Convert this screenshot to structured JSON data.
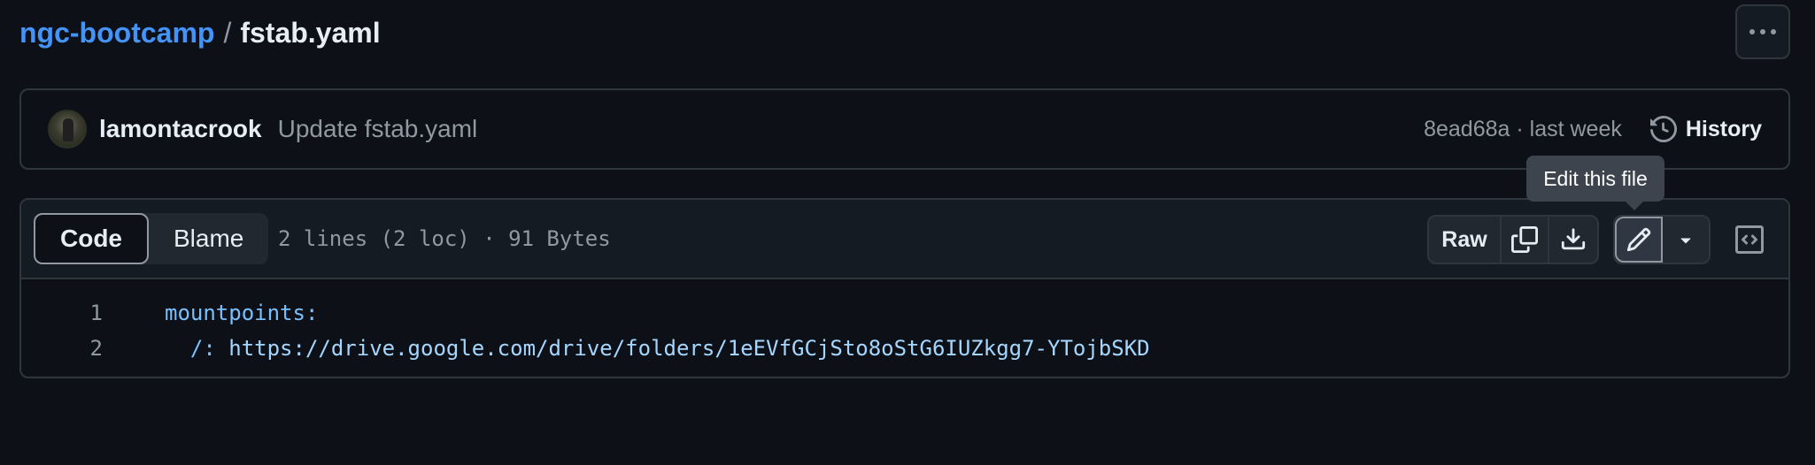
{
  "breadcrumb": {
    "repo": "ngc-bootcamp",
    "separator": "/",
    "file": "fstab.yaml"
  },
  "commit": {
    "author": "lamontacrook",
    "message": "Update fstab.yaml",
    "meta": "8ead68a · last week",
    "history_label": "History"
  },
  "tooltip": {
    "text": "Edit this file"
  },
  "file_toolbar": {
    "code_tab": "Code",
    "blame_tab": "Blame",
    "info": "2 lines (2 loc) · 91 Bytes",
    "raw_label": "Raw"
  },
  "code": {
    "lines": [
      {
        "number": "1",
        "text": "mountpoints:"
      },
      {
        "number": "2",
        "prefix": "  /: ",
        "url": "https://drive.google.com/drive/folders/1eEVfGCjSto8oStG6IUZkgg7-YTojbSKD"
      }
    ]
  },
  "icons": {
    "more": "kebab-horizontal-icon",
    "history": "history-icon",
    "copy": "copy-icon",
    "download": "download-icon",
    "edit": "pencil-icon",
    "dropdown": "triangle-down-icon",
    "symbols": "code-square-icon"
  },
  "colors": {
    "background": "#0d1117",
    "link": "#4493f8",
    "border": "#30363d",
    "muted": "#9198a1",
    "code_keyword": "#79c0ff",
    "code_string": "#a5d6ff"
  }
}
